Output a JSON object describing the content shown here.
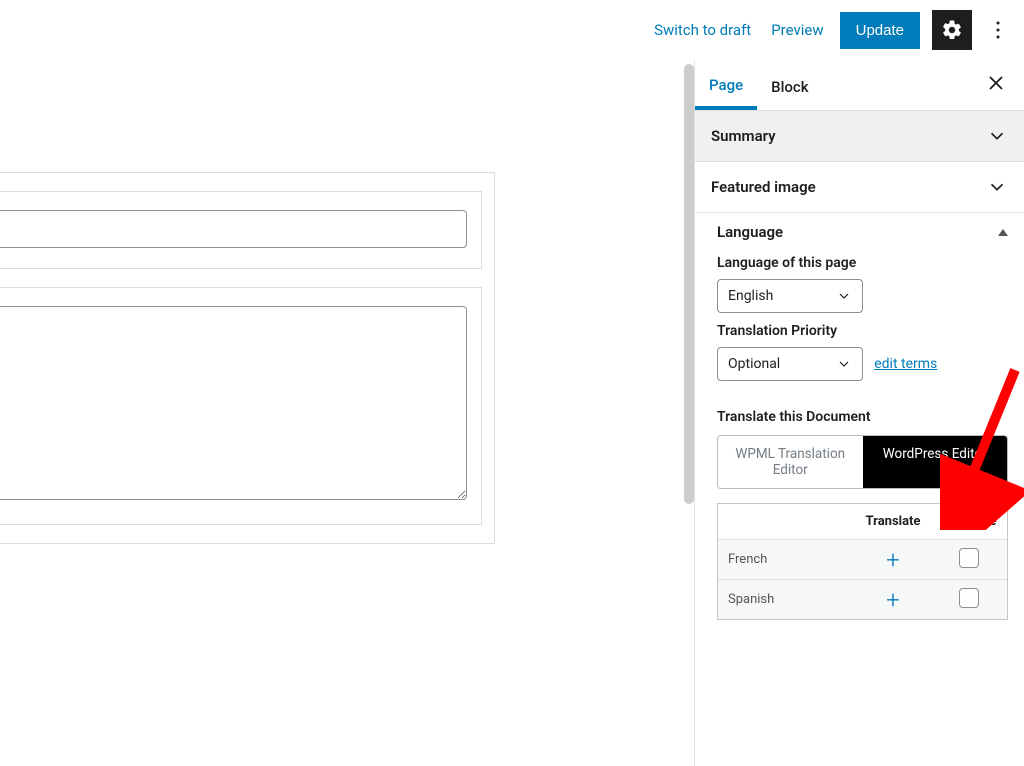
{
  "topbar": {
    "switch_to_draft": "Switch to draft",
    "preview": "Preview",
    "update": "Update"
  },
  "sidebar": {
    "tabs": {
      "page": "Page",
      "block": "Block"
    },
    "summary": "Summary",
    "featured_image": "Featured image",
    "language_panel": {
      "title": "Language",
      "language_of_page_label": "Language of this page",
      "language_value": "English",
      "priority_label": "Translation Priority",
      "priority_value": "Optional",
      "edit_terms": "edit terms",
      "translate_doc": "Translate this Document",
      "seg_left": "WPML Translation Editor",
      "seg_right": "WordPress Editor",
      "table": {
        "col_translate": "Translate",
        "col_duplicate": "Duplicate",
        "rows": [
          {
            "lang": "French"
          },
          {
            "lang": "Spanish"
          }
        ]
      }
    }
  }
}
